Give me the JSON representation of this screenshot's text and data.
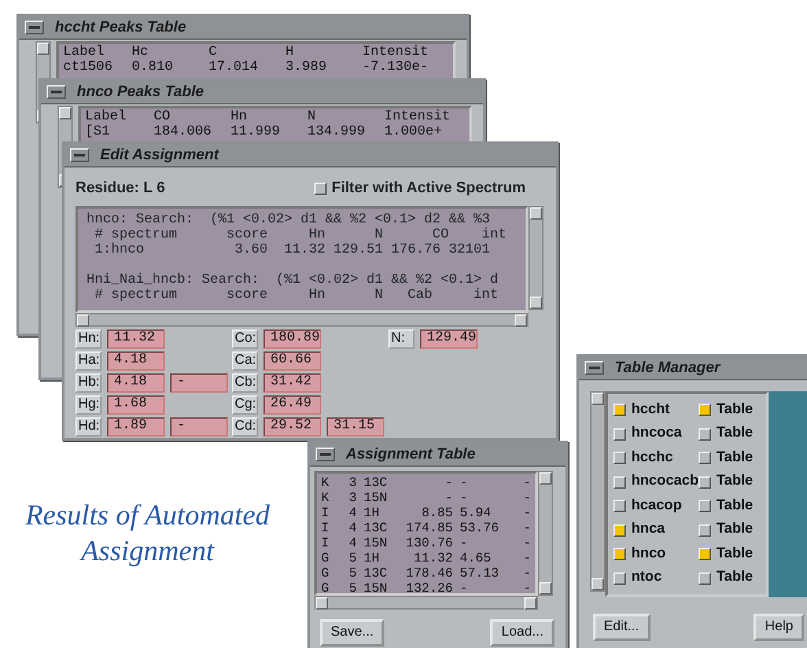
{
  "hccht_window": {
    "title": "hccht Peaks Table",
    "columns": [
      "Label",
      "Hc",
      "C",
      "H",
      "Intensit"
    ],
    "rows": [
      [
        "ct1506",
        "0.810",
        "17.014",
        "3.989",
        "-7.130e-"
      ]
    ]
  },
  "hnco_window": {
    "title": "hnco Peaks Table",
    "columns": [
      "Label",
      "CO",
      "Hn",
      "N",
      "Intensit"
    ],
    "rows": [
      [
        "[S1",
        "184.006",
        "11.999",
        "134.999",
        "1.000e+"
      ]
    ]
  },
  "edit_window": {
    "title": "Edit Assignment",
    "residue": "Residue: L 6",
    "filter": {
      "label": "Filter with Active Spectrum",
      "checked": false
    },
    "search_blocks": [
      {
        "lines": [
          "hnco: Search:  (%1 <0.02> d1 && %2 <0.1> d2 && %3",
          " # spectrum      score     Hn      N      CO    int",
          " 1:hnco           3.60  11.32 129.51 176.76 32101"
        ]
      },
      {
        "lines": [
          "Hni_Nai_hncb: Search:  (%1 <0.02> d1 && %2 <0.1> d",
          " # spectrum      score     Hn      N   Cab     int"
        ]
      }
    ],
    "field_rows": [
      [
        {
          "label": "Hn:",
          "values": [
            "11.32"
          ]
        },
        {
          "label": "Co:",
          "values": [
            "180.89"
          ]
        },
        {
          "label": "N:",
          "values": [
            "129.49"
          ]
        }
      ],
      [
        {
          "label": "Ha:",
          "values": [
            "4.18"
          ]
        },
        {
          "label": "Ca:",
          "values": [
            "60.66"
          ]
        }
      ],
      [
        {
          "label": "Hb:",
          "values": [
            "4.18",
            "-"
          ]
        },
        {
          "label": "Cb:",
          "values": [
            "31.42"
          ]
        }
      ],
      [
        {
          "label": "Hg:",
          "values": [
            "1.68"
          ]
        },
        {
          "label": "Cg:",
          "values": [
            "26.49"
          ]
        }
      ],
      [
        {
          "label": "Hd:",
          "values": [
            "1.89",
            "-"
          ]
        },
        {
          "label": "Cd:",
          "values": [
            "29.52",
            "31.15"
          ]
        }
      ]
    ]
  },
  "caption": "Results of Automated Assignment",
  "assignment_window": {
    "title": "Assignment Table",
    "rows": [
      [
        "K",
        "3",
        "13C",
        "-",
        "-",
        "-"
      ],
      [
        "K",
        "3",
        "15N",
        "-",
        "-",
        "-"
      ],
      [
        "I",
        "4",
        "1H",
        "8.85",
        "5.94",
        "-"
      ],
      [
        "I",
        "4",
        "13C",
        "174.85",
        "53.76",
        "-"
      ],
      [
        "I",
        "4",
        "15N",
        "130.76",
        "-",
        "-"
      ],
      [
        "G",
        "5",
        "1H",
        "11.32",
        "4.65",
        "-"
      ],
      [
        "G",
        "5",
        "13C",
        "178.46",
        "57.13",
        "-"
      ],
      [
        "G",
        "5",
        "15N",
        "132.26",
        "-",
        "-"
      ]
    ],
    "buttons": [
      "Save...",
      "Load..."
    ]
  },
  "table_manager": {
    "title": "Table Manager",
    "rows": [
      {
        "name": "hccht",
        "checked": true,
        "table": "Table",
        "table_checked": true
      },
      {
        "name": "hncoca",
        "checked": false,
        "table": "Table",
        "table_checked": false
      },
      {
        "name": "hcchc",
        "checked": false,
        "table": "Table",
        "table_checked": false
      },
      {
        "name": "hncocacb",
        "checked": false,
        "table": "Table",
        "table_checked": false
      },
      {
        "name": "hcacop",
        "checked": false,
        "table": "Table",
        "table_checked": false
      },
      {
        "name": "hnca",
        "checked": true,
        "table": "Table",
        "table_checked": false
      },
      {
        "name": "hnco",
        "checked": true,
        "table": "Table",
        "table_checked": true
      },
      {
        "name": "ntoc",
        "checked": false,
        "table": "Table",
        "table_checked": false
      }
    ],
    "buttons": [
      "Edit...",
      "Help"
    ]
  }
}
